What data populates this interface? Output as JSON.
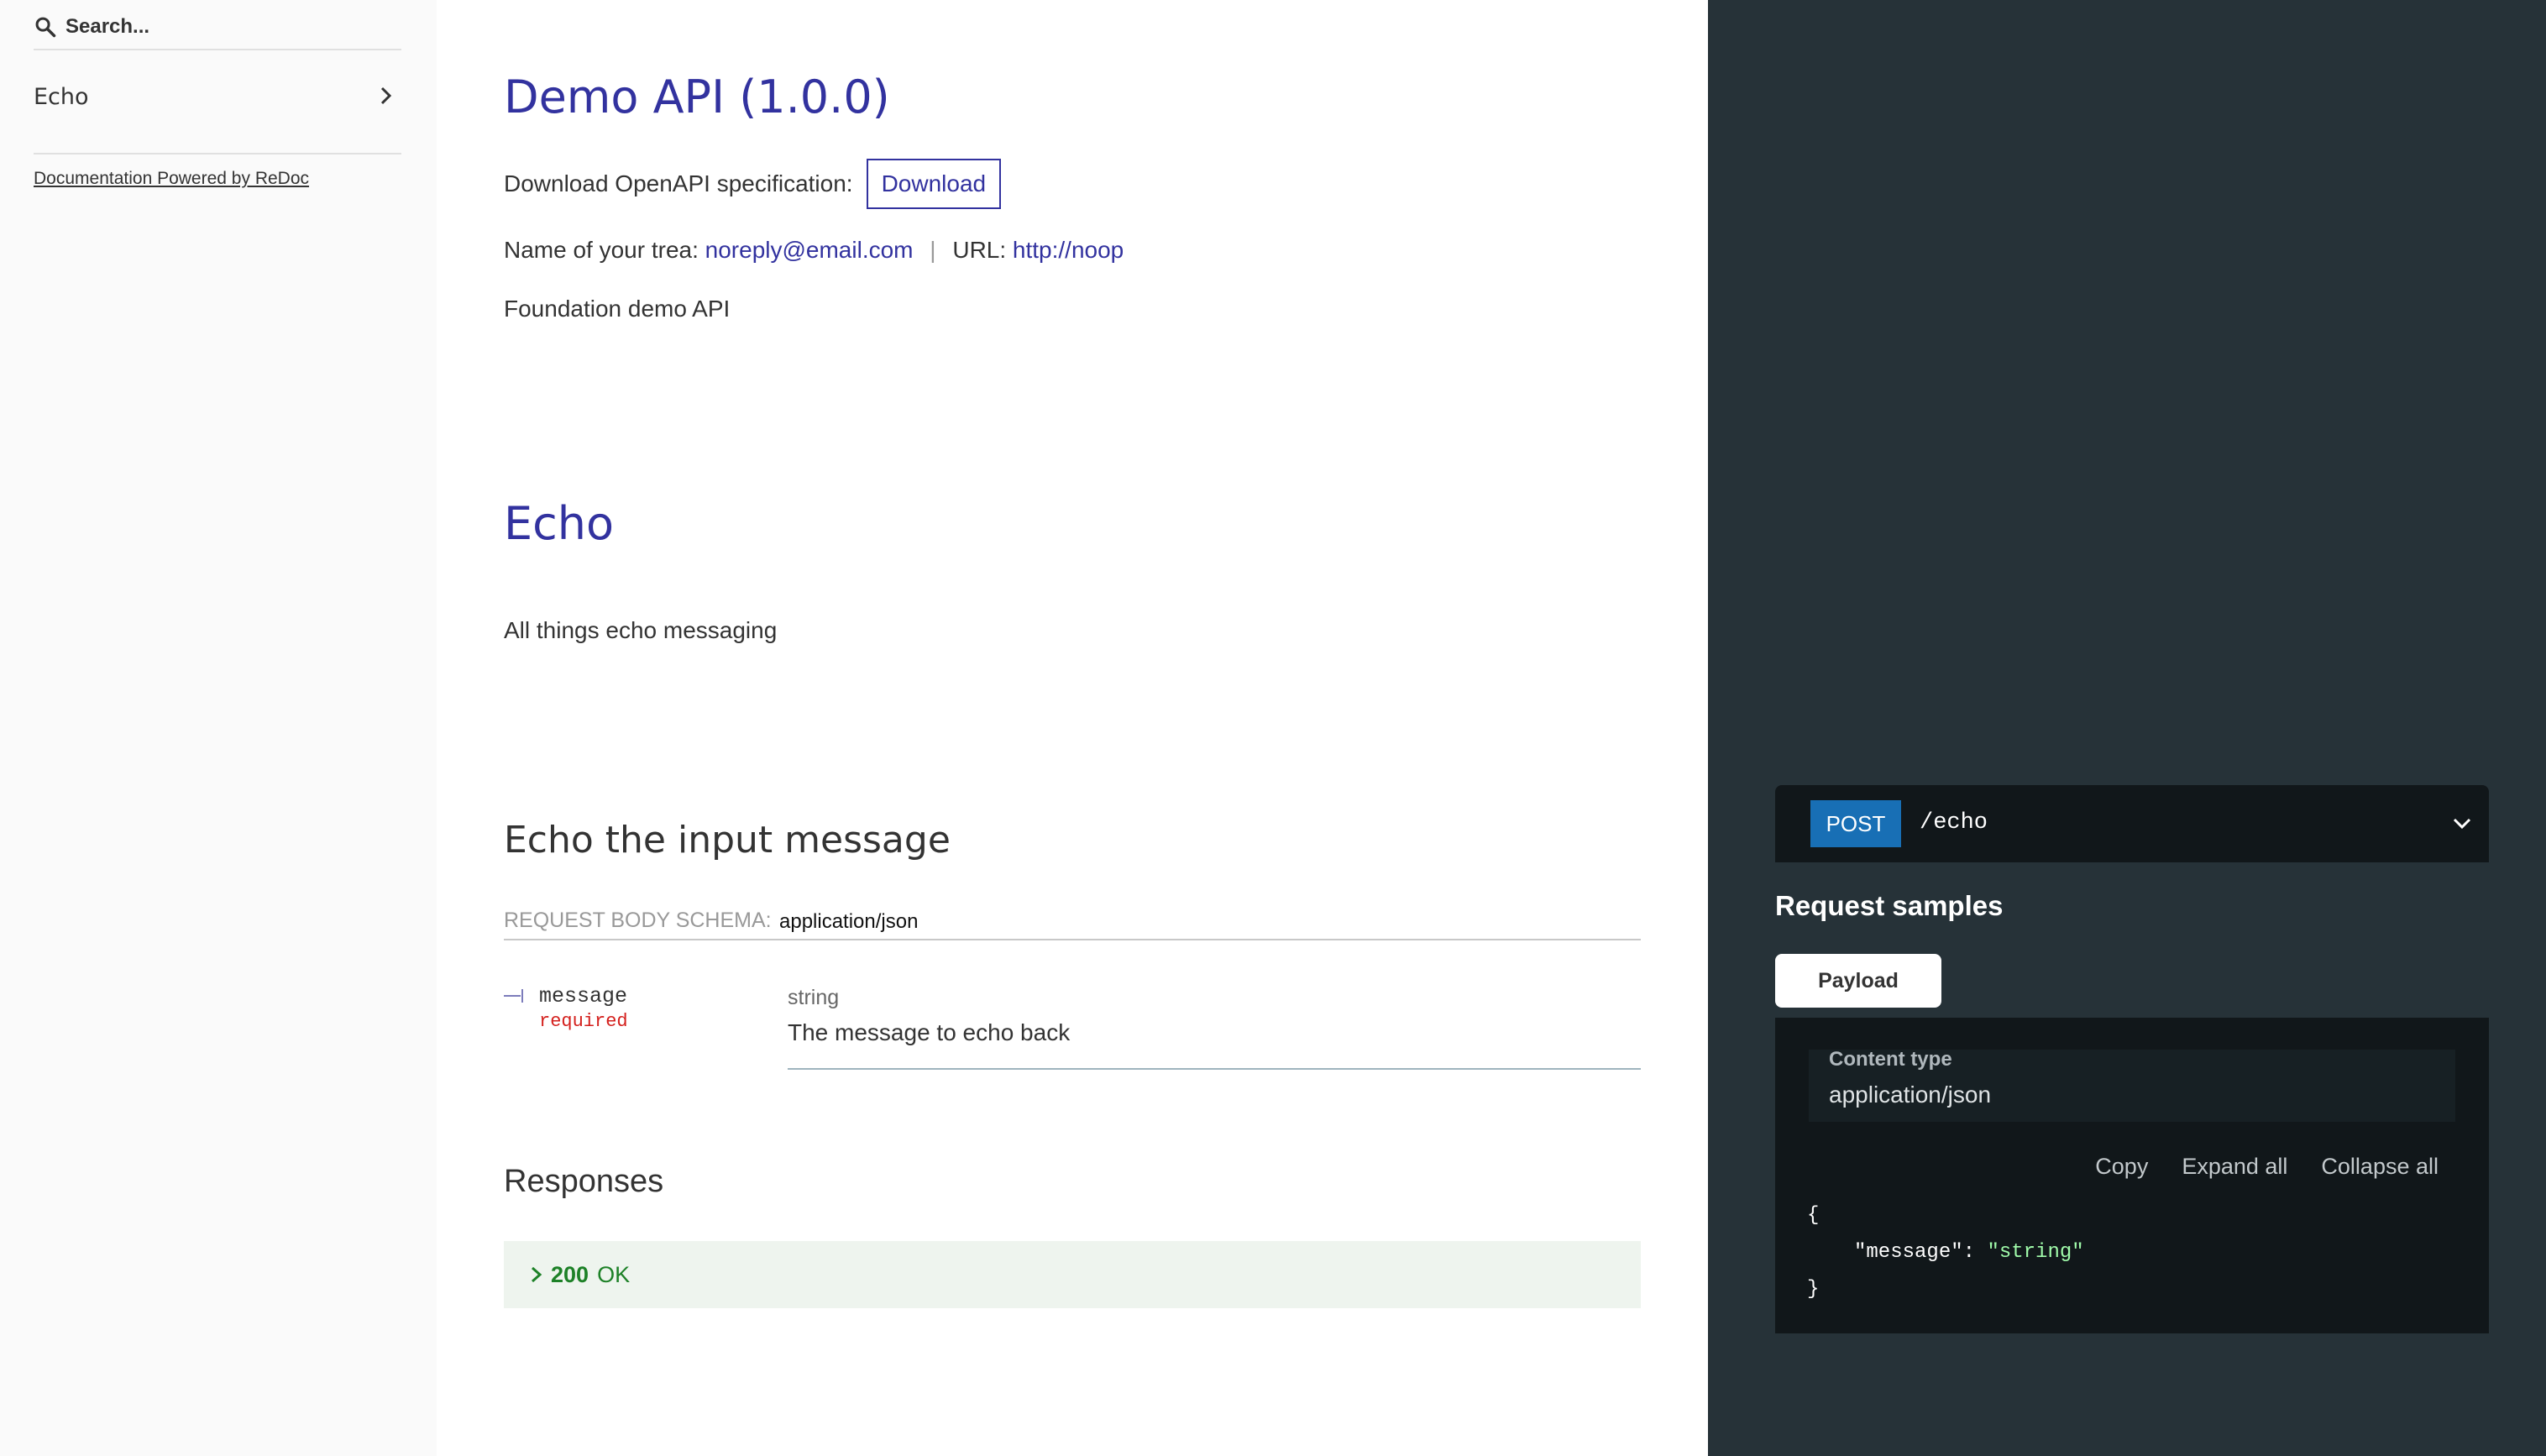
{
  "sidebar": {
    "search_placeholder": "Search...",
    "items": [
      {
        "label": "Echo"
      }
    ],
    "powered_by": "Documentation Powered by ReDoc"
  },
  "info": {
    "title": "Demo API (1.0.0)",
    "download_label": "Download OpenAPI specification:",
    "download_button": "Download",
    "contact_prefix": "Name of your trea:",
    "contact_email": "noreply@email.com",
    "separator": "|",
    "url_prefix": "URL:",
    "url": "http://noop",
    "description": "Foundation demo API"
  },
  "tag": {
    "title": "Echo",
    "description": "All things echo messaging"
  },
  "operation": {
    "title": "Echo the input message",
    "request_body_label": "REQUEST BODY SCHEMA:",
    "request_body_type": "application/json",
    "params": [
      {
        "name": "message",
        "required": "required",
        "type": "string",
        "description": "The message to echo back"
      }
    ],
    "responses_title": "Responses",
    "responses": [
      {
        "code": "200",
        "text": "OK"
      }
    ]
  },
  "samples": {
    "method": "POST",
    "path": "/echo",
    "title": "Request samples",
    "tab": "Payload",
    "content_type_label": "Content type",
    "content_type_value": "application/json",
    "actions": {
      "copy": "Copy",
      "expand": "Expand all",
      "collapse": "Collapse all"
    },
    "code": {
      "open": "{",
      "key": "\"message\"",
      "colon": ": ",
      "value": "\"string\"",
      "close": "}"
    }
  },
  "colors": {
    "primary": "#32329f",
    "post_badge": "#186fb5",
    "required": "#d41f1c",
    "success": "#1d8127",
    "right_panel_bg": "#263238"
  }
}
